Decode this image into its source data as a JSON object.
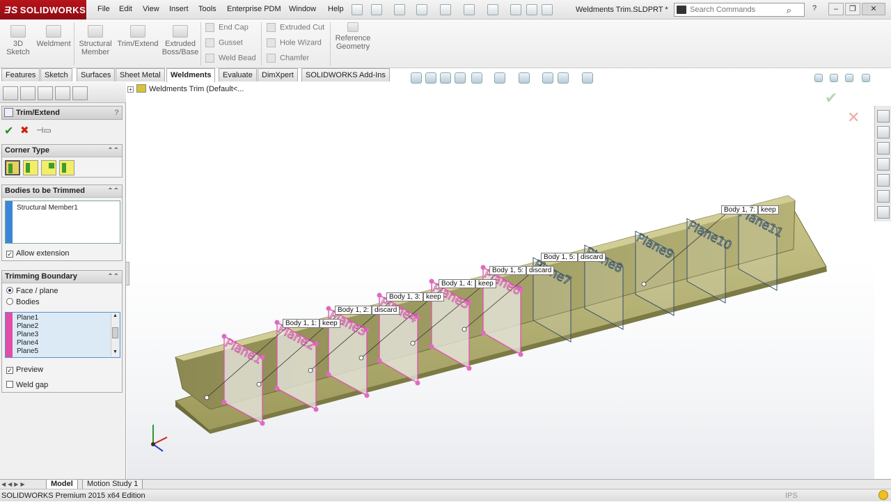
{
  "app": {
    "brand": "SOLIDWORKS",
    "document_title": "Weldments Trim.SLDPRT *"
  },
  "menu": [
    "File",
    "Edit",
    "View",
    "Insert",
    "Tools",
    "Enterprise PDM",
    "Window",
    "Help"
  ],
  "search": {
    "placeholder": "Search Commands"
  },
  "command_manager": {
    "big": [
      {
        "label": "3D Sketch",
        "icon": "3d-sketch-icon"
      },
      {
        "label": "Weldment",
        "icon": "weldment-icon"
      },
      {
        "label": "Structural Member",
        "icon": "structural-member-icon"
      },
      {
        "label": "Trim/Extend",
        "icon": "trim-extend-icon"
      },
      {
        "label": "Extruded Boss/Base",
        "icon": "extruded-boss-icon"
      }
    ],
    "small_col1": [
      "End Cap",
      "Gusset",
      "Weld Bead"
    ],
    "small_col2": [
      "Extruded Cut",
      "Hole Wizard",
      "Chamfer"
    ],
    "reference_geometry": "Reference Geometry"
  },
  "tabs": [
    "Features",
    "Sketch",
    "Surfaces",
    "Sheet Metal",
    "Weldments",
    "Evaluate",
    "DimXpert",
    "SOLIDWORKS Add-Ins"
  ],
  "active_tab": "Weldments",
  "feature_tree": {
    "flyout_label": "Weldments Trim  (Default<..."
  },
  "property_manager": {
    "title": "Trim/Extend",
    "help": "?",
    "corner_type": {
      "heading": "Corner Type"
    },
    "bodies_to_trim": {
      "heading": "Bodies to be Trimmed",
      "items": [
        "Structural Member1"
      ],
      "allow_extension_label": "Allow extension",
      "allow_extension": true
    },
    "trimming_boundary": {
      "heading": "Trimming Boundary",
      "options": [
        "Face / plane",
        "Bodies"
      ],
      "selected": "Face / plane",
      "planes": [
        "Plane1",
        "Plane2",
        "Plane3",
        "Plane4",
        "Plane5"
      ],
      "preview_label": "Preview",
      "preview": true,
      "weld_gap_label": "Weld gap",
      "weld_gap": false
    }
  },
  "graphics": {
    "plane_labels": [
      "Plane1",
      "Plane2",
      "Plane3",
      "Plane4",
      "Plane5",
      "Plane6",
      "Plane7",
      "Plane8",
      "Plane9",
      "Plane10",
      "Plane11"
    ],
    "callouts": [
      {
        "body": "Body  1,   1:",
        "action": "keep"
      },
      {
        "body": "Body  1,   2:",
        "action": "discard"
      },
      {
        "body": "Body  1,   3:",
        "action": "keep"
      },
      {
        "body": "Body  1,   4:",
        "action": "keep"
      },
      {
        "body": "Body  1,   5:",
        "action": "discard"
      },
      {
        "body": "Body  1,   5:",
        "action": "discard"
      },
      {
        "body": "Body  1,   7:",
        "action": "keep"
      }
    ],
    "model_color": "#a9a66b",
    "accent_pink": "#e050b0"
  },
  "bottom_tabs": [
    "Model",
    "Motion Study 1"
  ],
  "status": {
    "edition": "SOLIDWORKS Premium 2015 x64 Edition",
    "units": "IPS"
  }
}
